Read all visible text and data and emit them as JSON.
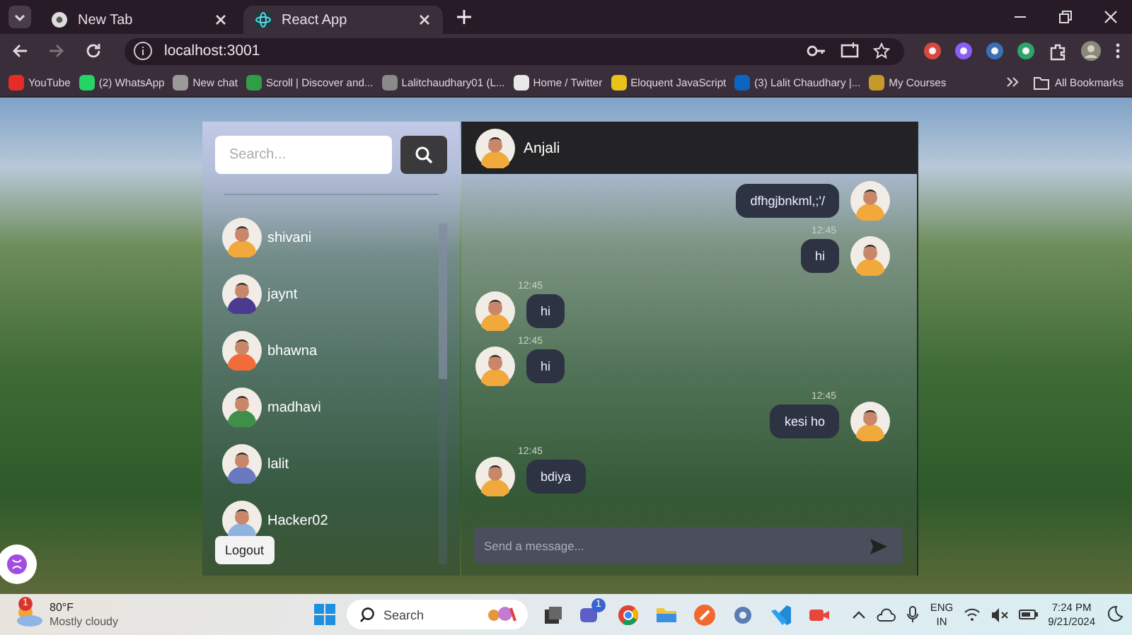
{
  "browser": {
    "tabs": [
      {
        "title": "New Tab",
        "selected": false
      },
      {
        "title": "React App",
        "selected": true
      }
    ],
    "address": "localhost:3001",
    "bookmarks": [
      "YouTube",
      "(2) WhatsApp",
      "New chat",
      "Scroll | Discover and...",
      "Lalitchaudhary01 (L...",
      "Home / Twitter",
      "Eloquent JavaScript",
      "(3) Lalit Chaudhary |...",
      "My Courses"
    ],
    "all_bookmarks": "All Bookmarks"
  },
  "app": {
    "search": {
      "placeholder": "Search..."
    },
    "contacts": [
      {
        "name": "shivani"
      },
      {
        "name": "jaynt"
      },
      {
        "name": "bhawna"
      },
      {
        "name": "madhavi"
      },
      {
        "name": "lalit"
      },
      {
        "name": "Hacker02"
      }
    ],
    "logout": "Logout",
    "chat": {
      "name": "Anjali",
      "messages": [
        {
          "kind": "sent",
          "text": "dfhgjbnkml,;'/"
        },
        {
          "kind": "sent",
          "text": "hi",
          "time": "12:45"
        },
        {
          "kind": "received",
          "text": "hi",
          "time": "12:45"
        },
        {
          "kind": "received",
          "text": "hi",
          "time": "12:45"
        },
        {
          "kind": "sent",
          "text": "kesi ho",
          "time": "12:45"
        },
        {
          "kind": "received",
          "text": "bdiya",
          "time": "12:45"
        }
      ],
      "composer": {
        "placeholder": "Send a message..."
      }
    }
  },
  "taskbar": {
    "weather": {
      "badge": "1",
      "temperature": "80°F",
      "condition": "Mostly cloudy"
    },
    "search": "Search",
    "chat_badge": "1",
    "language": "ENG",
    "region": "IN",
    "time": "7:24 PM",
    "date": "9/21/2024"
  }
}
